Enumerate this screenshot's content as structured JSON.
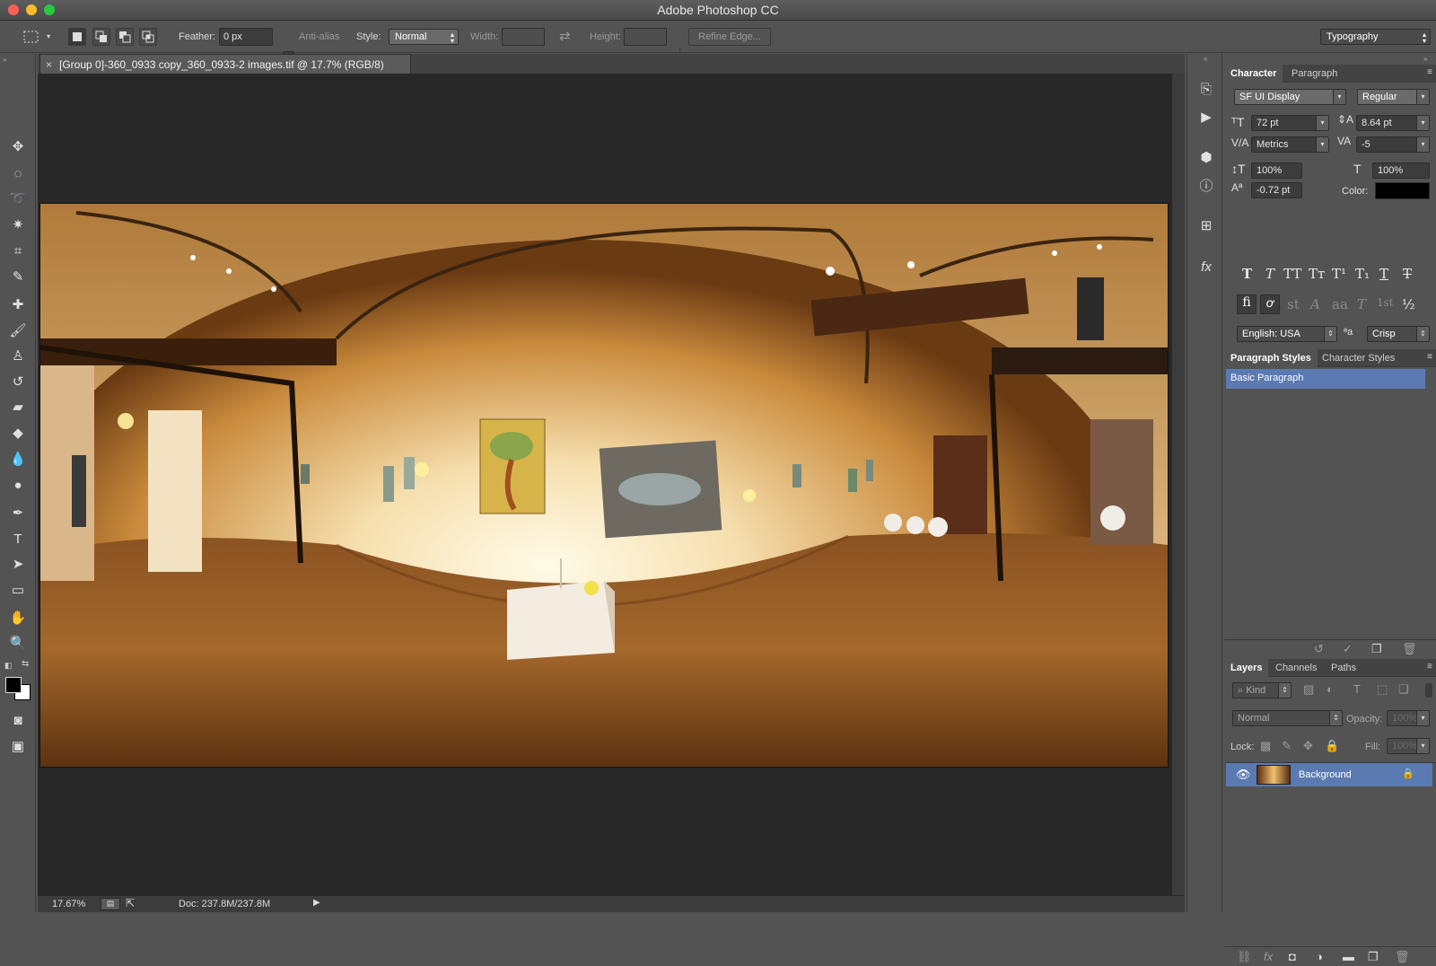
{
  "app": {
    "title": "Adobe Photoshop CC"
  },
  "options_bar": {
    "feather_label": "Feather:",
    "feather_value": "0 px",
    "antialias_label": "Anti-alias",
    "style_label": "Style:",
    "style_value": "Normal",
    "width_label": "Width:",
    "height_label": "Height:",
    "refine_edge": "Refine Edge...",
    "workspace": "Typography"
  },
  "document": {
    "tab_close": "×",
    "tab_title": "[Group 0]-360_0933 copy_360_0933-2 images.tif @ 17.7% (RGB/8)",
    "zoom": "17.67%",
    "doc_size": "Doc: 237.8M/237.8M"
  },
  "character_panel": {
    "tabs": [
      "Character",
      "Paragraph"
    ],
    "font_family": "SF UI Display",
    "font_style": "Regular",
    "font_size": "72 pt",
    "leading": "8.64 pt",
    "kerning": "Metrics",
    "tracking": "-5",
    "vertical_scale": "100%",
    "horizontal_scale": "100%",
    "baseline_shift": "-0.72 pt",
    "color_label": "Color:",
    "color_value": "#000000",
    "language": "English: USA",
    "antialias": "Crisp",
    "type_buttons": [
      "T",
      "T",
      "TT",
      "Tт",
      "T¹",
      "T₁",
      "T",
      "T"
    ],
    "opentype_buttons": [
      "fi",
      "ơ",
      "st",
      "A",
      "aa",
      "T",
      "1st",
      "½"
    ]
  },
  "styles_panel": {
    "tabs": [
      "Paragraph Styles",
      "Character Styles"
    ],
    "items": [
      "Basic Paragraph"
    ]
  },
  "layers_panel": {
    "tabs": [
      "Layers",
      "Channels",
      "Paths"
    ],
    "filter_kind": "Kind",
    "blend_mode": "Normal",
    "opacity_label": "Opacity:",
    "opacity_value": "100%",
    "lock_label": "Lock:",
    "fill_label": "Fill:",
    "fill_value": "100%",
    "layers": [
      {
        "name": "Background",
        "visible": true,
        "locked": true
      }
    ]
  },
  "colors": {
    "accent_selection": "#5b7ab1",
    "canvas_bg": "#282828",
    "panel_bg": "#535353"
  }
}
